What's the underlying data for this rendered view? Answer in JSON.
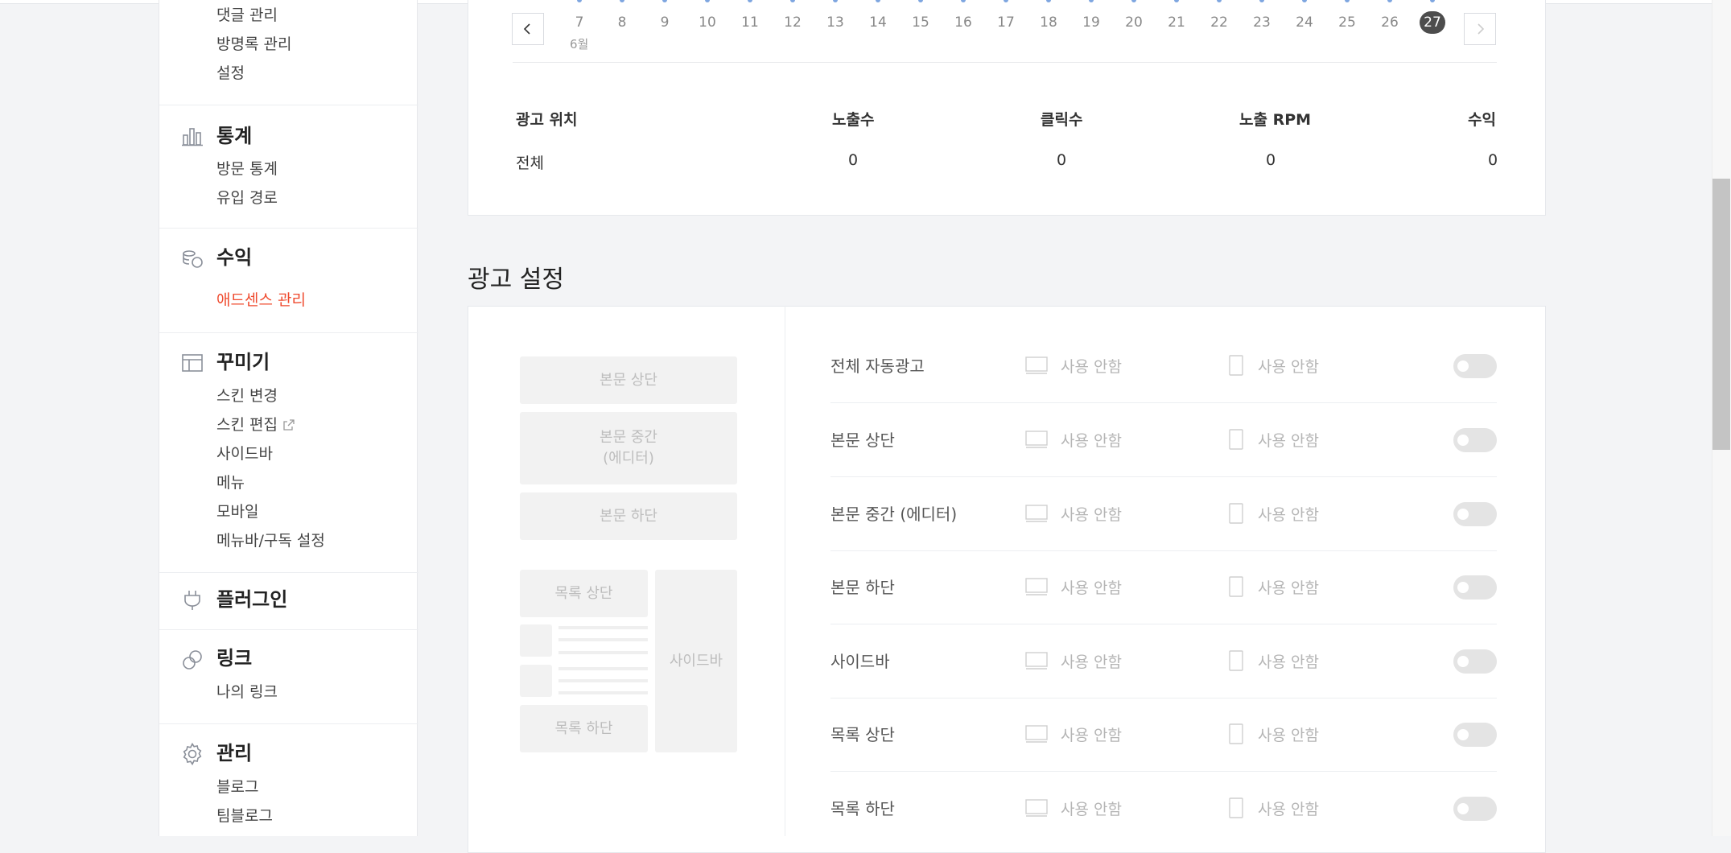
{
  "sidebar": {
    "top_items": [
      "댓글 관리",
      "방명록 관리",
      "설정"
    ],
    "stats": {
      "heading": "통계",
      "items": [
        "방문 통계",
        "유입 경로"
      ]
    },
    "revenue": {
      "heading": "수익",
      "items": [
        "애드센스 관리"
      ]
    },
    "decor": {
      "heading": "꾸미기",
      "items": [
        "스킨 변경",
        "스킨 편집",
        "사이드바",
        "메뉴",
        "모바일",
        "메뉴바/구독 설정"
      ]
    },
    "plugin": {
      "heading": "플러그인"
    },
    "link": {
      "heading": "링크",
      "items": [
        "나의 링크"
      ]
    },
    "manage": {
      "heading": "관리",
      "items": [
        "블로그",
        "팀블로그"
      ]
    }
  },
  "dates": {
    "days": [
      "7",
      "8",
      "9",
      "10",
      "11",
      "12",
      "13",
      "14",
      "15",
      "16",
      "17",
      "18",
      "19",
      "20",
      "21",
      "22",
      "23",
      "24",
      "25",
      "26",
      "27"
    ],
    "selected": "27",
    "month": "6월"
  },
  "table": {
    "headers": [
      "광고 위치",
      "노출수",
      "클릭수",
      "노출 RPM",
      "수익"
    ],
    "row": [
      "전체",
      "0",
      "0",
      "0",
      "0"
    ]
  },
  "ad_settings": {
    "title": "광고 설정",
    "preview": {
      "body_top": "본문 상단",
      "body_mid_1": "본문 중간",
      "body_mid_2": "(에디터)",
      "body_bottom": "본문 하단",
      "list_top": "목록 상단",
      "list_bottom": "목록 하단",
      "sidebar": "사이드바"
    },
    "rows": [
      {
        "label": "전체 자동광고",
        "pc": "사용 안함",
        "mobile": "사용 안함"
      },
      {
        "label": "본문 상단",
        "pc": "사용 안함",
        "mobile": "사용 안함"
      },
      {
        "label": "본문 중간 (에디터)",
        "pc": "사용 안함",
        "mobile": "사용 안함"
      },
      {
        "label": "본문 하단",
        "pc": "사용 안함",
        "mobile": "사용 안함"
      },
      {
        "label": "사이드바",
        "pc": "사용 안함",
        "mobile": "사용 안함"
      },
      {
        "label": "목록 상단",
        "pc": "사용 안함",
        "mobile": "사용 안함"
      },
      {
        "label": "목록 하단",
        "pc": "사용 안함",
        "mobile": "사용 안함"
      }
    ]
  },
  "colors": {
    "active_menu": "#ef4b2f",
    "selected_date": "#4d4d4d",
    "toggle_off": "#e4e4e4"
  }
}
